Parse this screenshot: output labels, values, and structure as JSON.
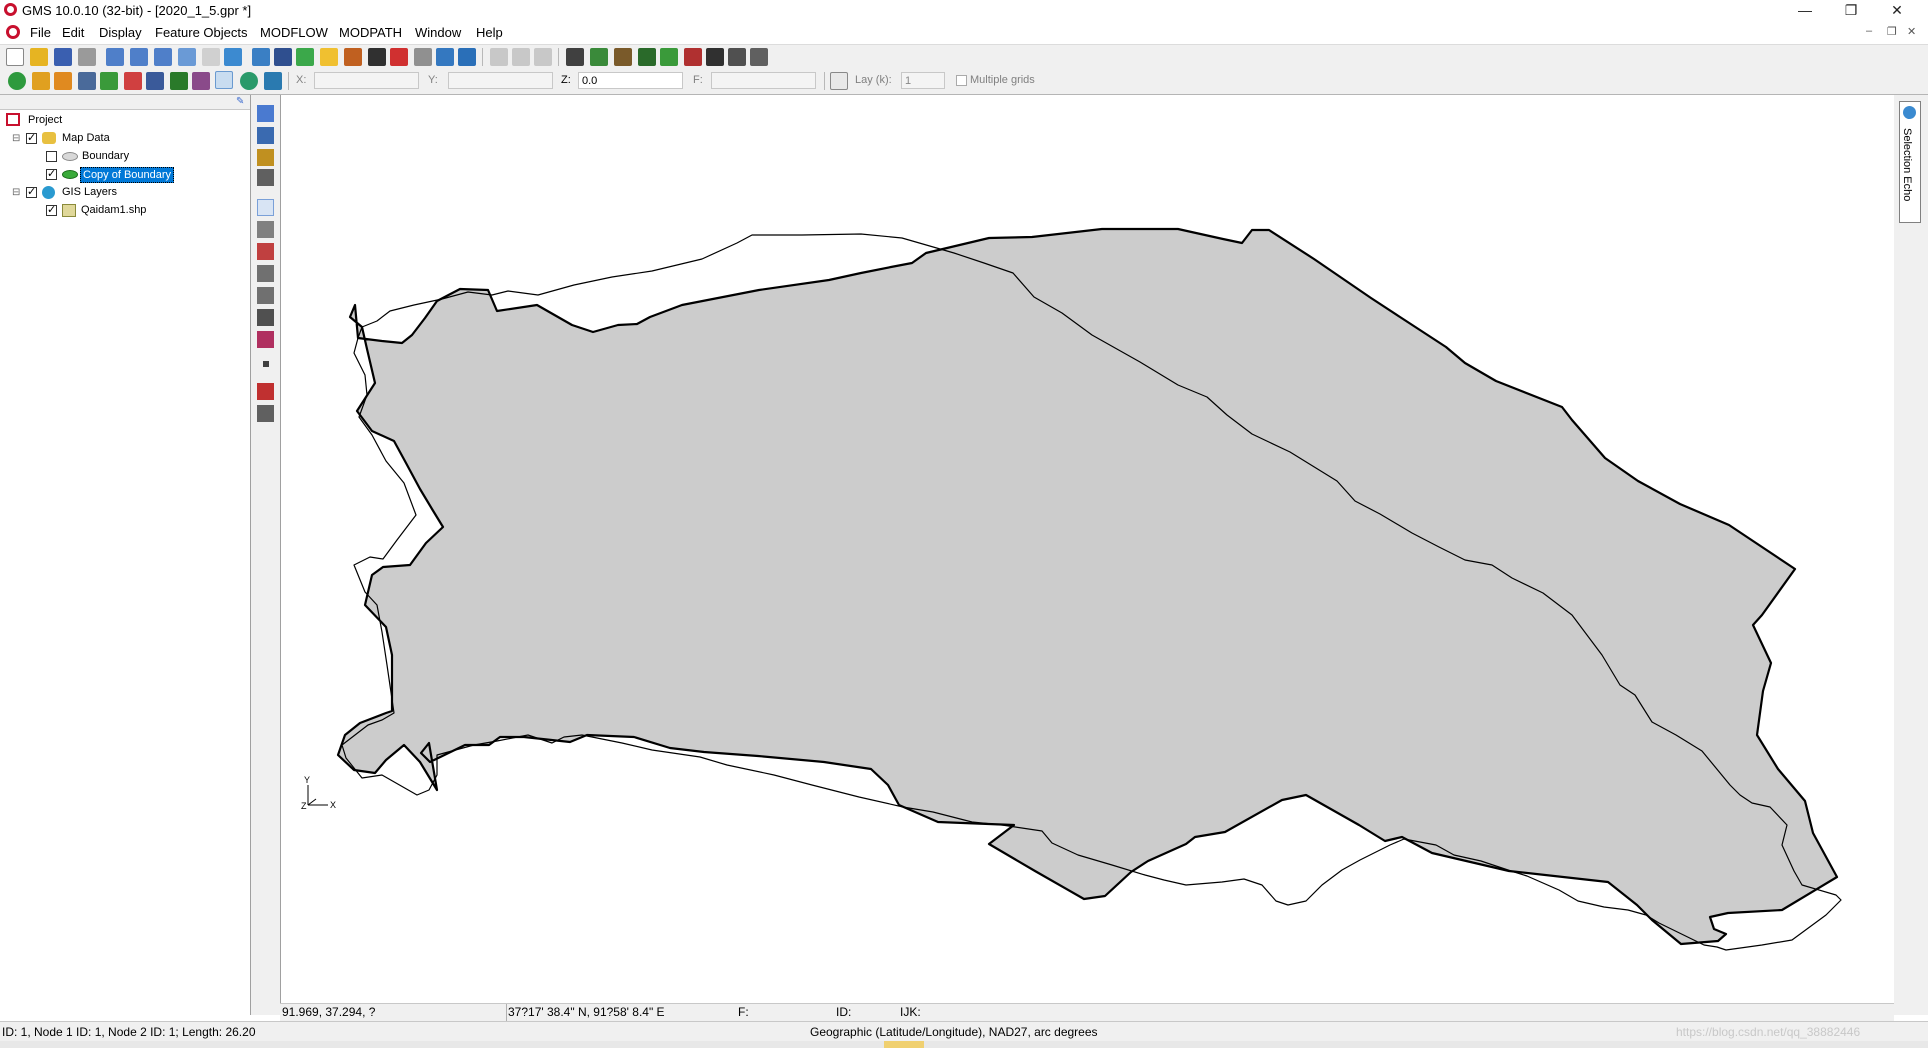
{
  "window": {
    "title": "GMS 10.0.10 (32-bit) - [2020_1_5.gpr *]",
    "buttons": {
      "minimize": "—",
      "restore": "❐",
      "close": "✕"
    }
  },
  "menu": {
    "items": [
      "File",
      "Edit",
      "Display",
      "Feature Objects",
      "MODFLOW",
      "MODPATH",
      "Window",
      "Help"
    ],
    "mdi_buttons": {
      "minimize": "–",
      "restore": "❐",
      "close": "✕"
    }
  },
  "coords": {
    "x_label": "X:",
    "y_label": "Y:",
    "z_label": "Z:",
    "z_value": "0.0",
    "f_label": "F:",
    "lay_label": "Lay (k):",
    "lay_value": "1",
    "multiple_grids": "Multiple grids"
  },
  "tree": {
    "root": "Project",
    "map_data": "Map Data",
    "boundary": "Boundary",
    "copy_of_boundary": "Copy of Boundary",
    "gis_layers": "GIS Layers",
    "shapefile": "Qaidam1.shp"
  },
  "right_dock": {
    "selection_echo": "Selection Echo"
  },
  "status": {
    "cursor_xyz": "91.969, 37.294, ?",
    "cursor_latlon": "37?17' 38.4\" N, 91?58' 8.4\" E",
    "f_label": "F:",
    "id_label": "ID:",
    "ijk_label": "IJK:",
    "selection_info": "ID: 1, Node 1 ID: 1, Node 2 ID: 1; Length: 26.20",
    "projection": "Geographic (Latitude/Longitude),  NAD27,  arc degrees",
    "watermark": "https://blog.csdn.net/qq_38882446"
  },
  "colors": {
    "polygon_fill": "#cccccc",
    "polygon_stroke": "#000000",
    "selected_highlight": "#0078d7",
    "brand_red": "#c8102e"
  }
}
